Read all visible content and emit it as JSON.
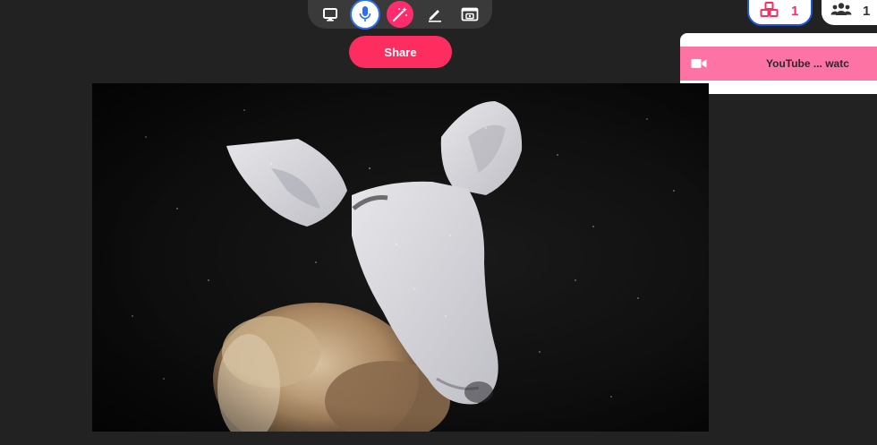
{
  "toolbar": {
    "tools": [
      {
        "name": "screen-icon",
        "active": false
      },
      {
        "name": "microphone-icon",
        "active": true
      },
      {
        "name": "magic-wand-icon",
        "active": true
      },
      {
        "name": "pen-icon",
        "active": false
      },
      {
        "name": "camera-window-icon",
        "active": false
      }
    ]
  },
  "share_button": {
    "label": "Share"
  },
  "top_right": {
    "boxes_pill": {
      "icon": "cubes-icon",
      "count": "1",
      "color": "#fe2d60"
    },
    "users_pill": {
      "icon": "users-icon",
      "count": "1"
    }
  },
  "media_card": {
    "item": {
      "icon": "video-camera-icon",
      "title": "YouTube ... watc"
    }
  },
  "video": {
    "content": "video-frame"
  },
  "colors": {
    "background": "#222222",
    "accent": "#fe2d60",
    "media_item": "#fd74a4",
    "focus_border": "#1d55d6"
  }
}
